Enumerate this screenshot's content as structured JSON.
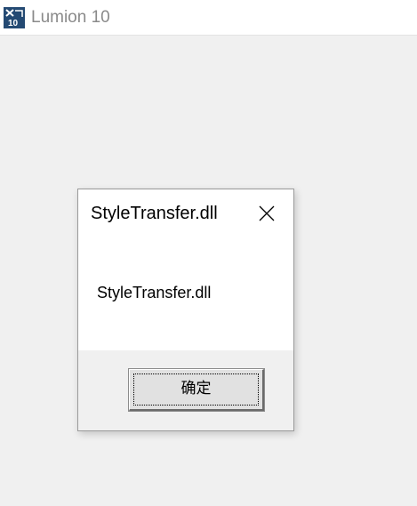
{
  "window": {
    "title": "Lumion 10",
    "icon": "lumion-app-icon",
    "icon_badge": "10"
  },
  "dialog": {
    "title": "StyleTransfer.dll",
    "message": "StyleTransfer.dll",
    "close_icon": "close-icon",
    "ok_label": "确定"
  },
  "colors": {
    "background": "#f0f0f0",
    "titlebar": "#ffffff",
    "title_text": "#8a8a8a",
    "app_icon": "#244a73",
    "dialog_bg": "#ffffff",
    "footer_bg": "#f0f0f0",
    "button_bg": "#e1e1e1"
  }
}
